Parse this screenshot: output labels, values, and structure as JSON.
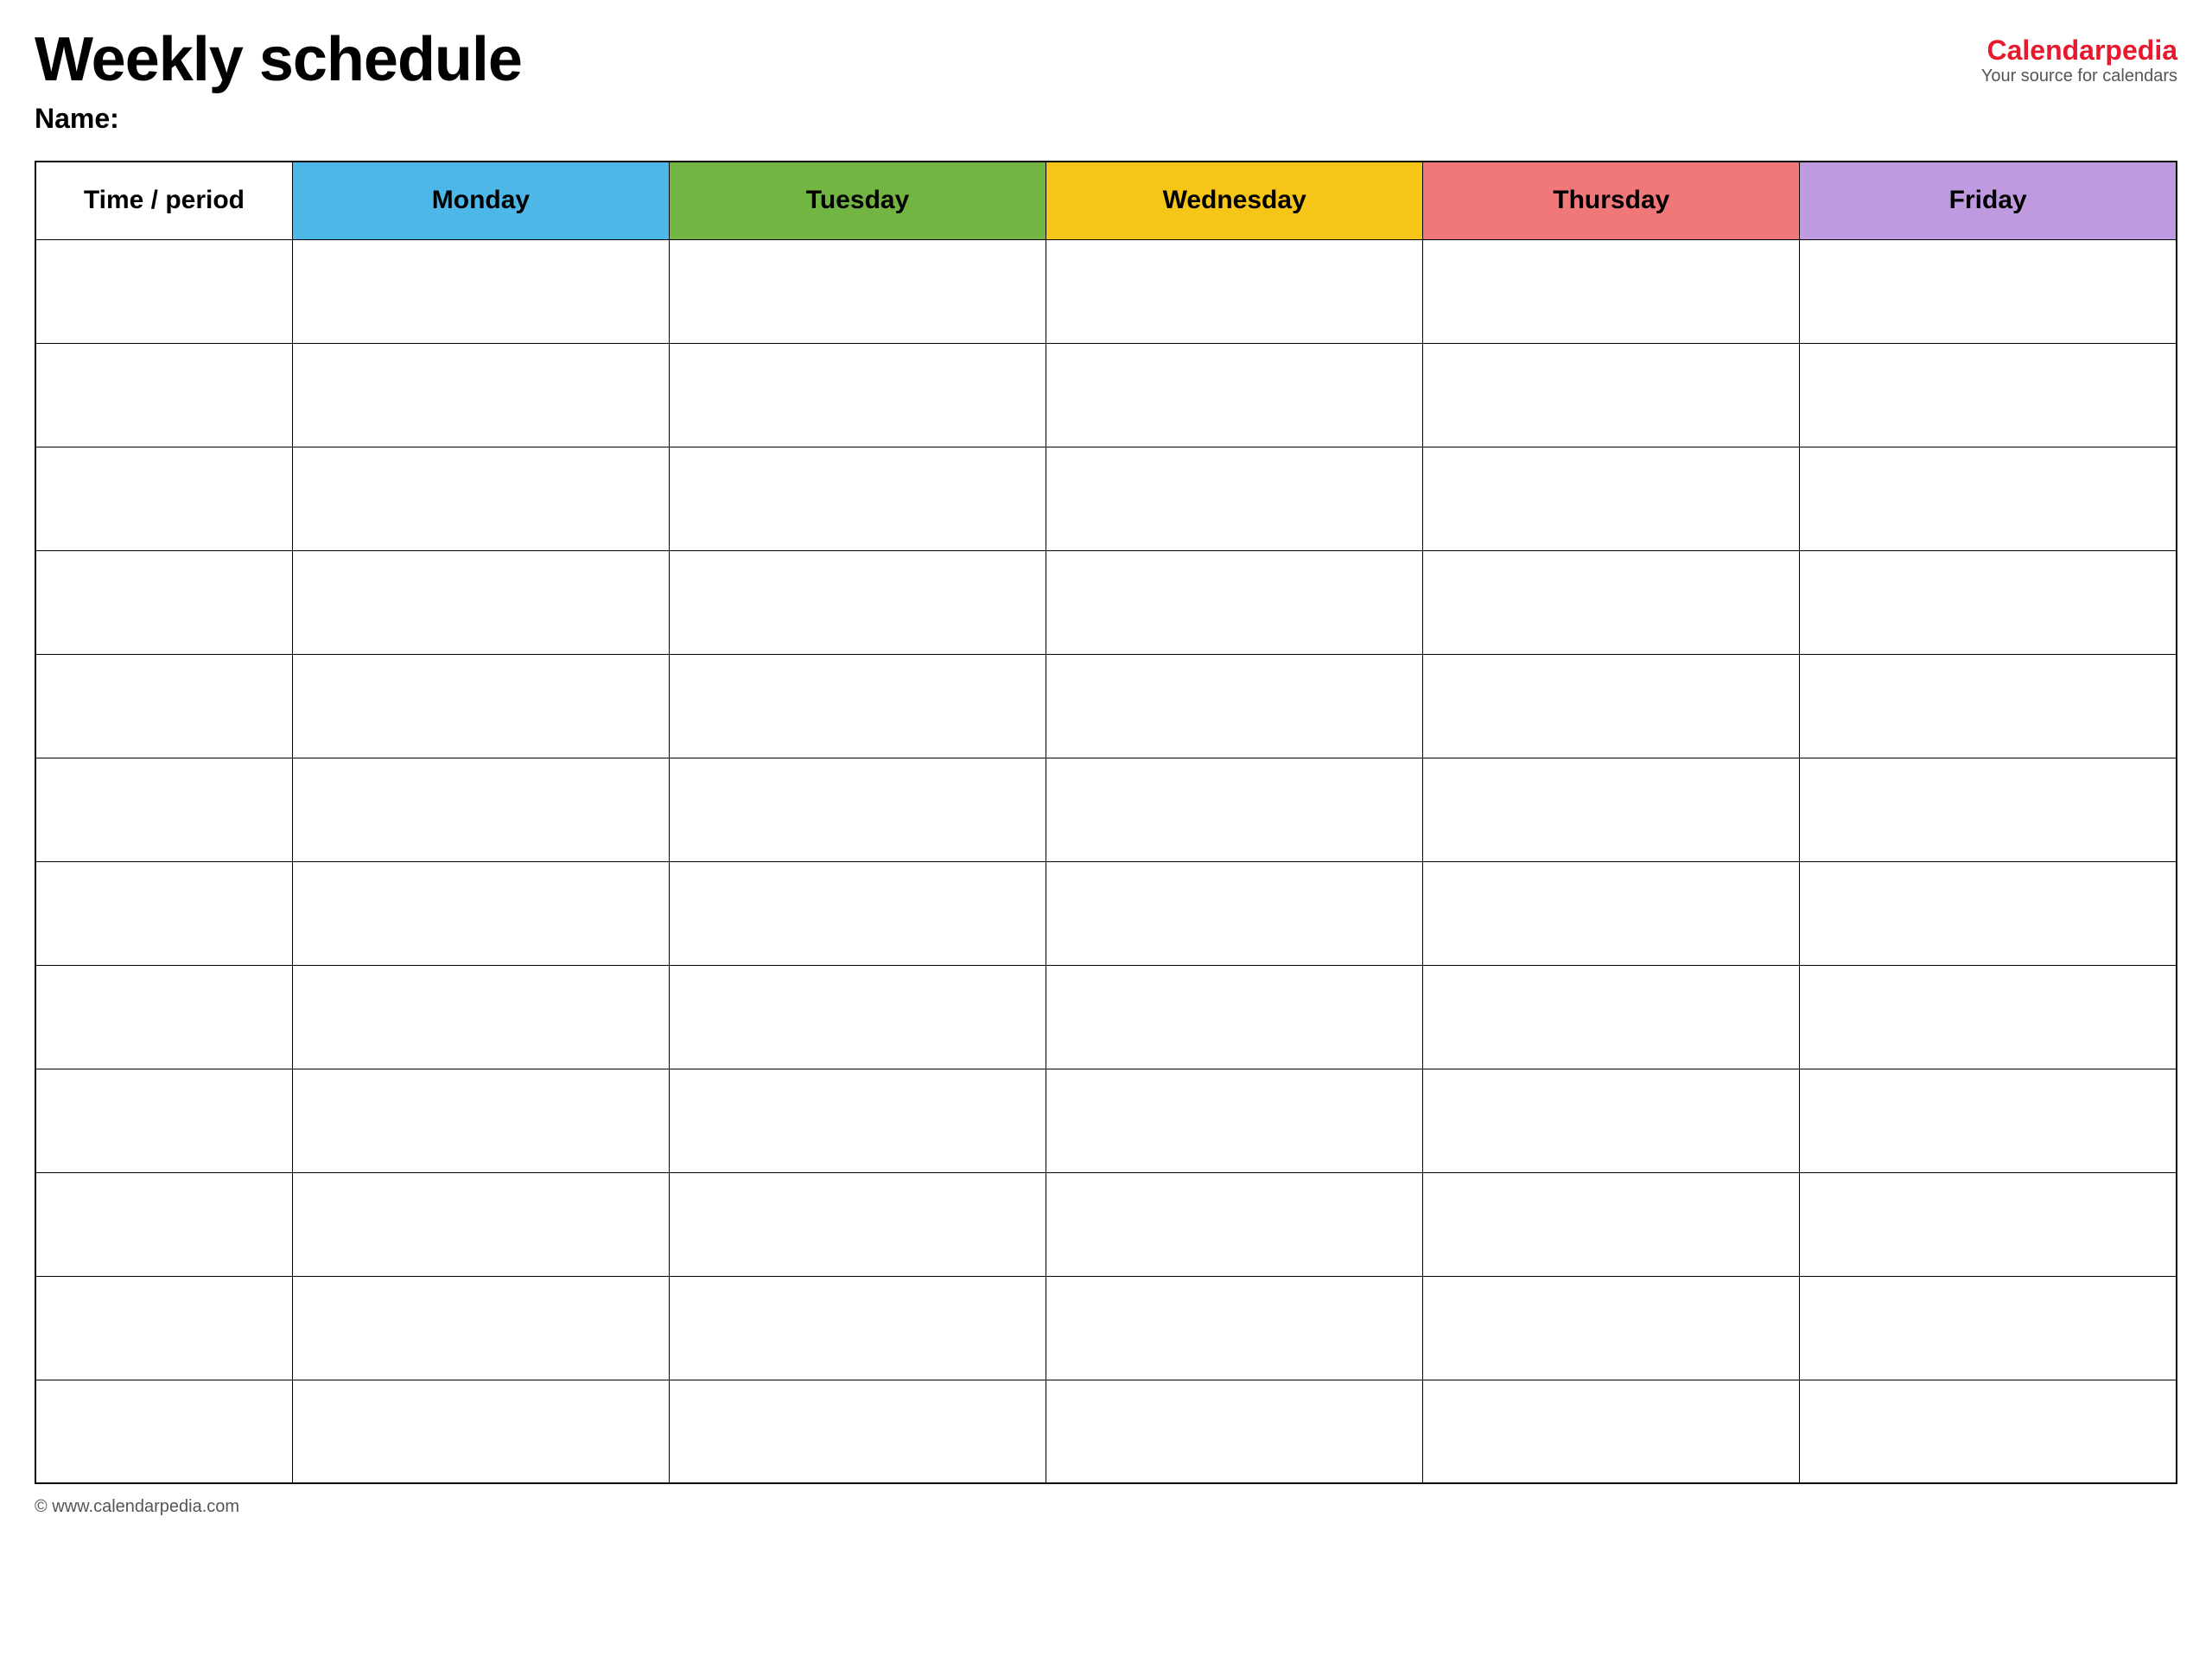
{
  "header": {
    "title": "Weekly schedule",
    "name_label": "Name:",
    "logo": {
      "text_black": "Calendar",
      "text_red": "pedia",
      "tagline": "Your source for calendars"
    }
  },
  "table": {
    "columns": [
      {
        "id": "time",
        "label": "Time / period",
        "color": "#ffffff",
        "class": "th-time"
      },
      {
        "id": "monday",
        "label": "Monday",
        "color": "#4db8e8",
        "class": "th-monday"
      },
      {
        "id": "tuesday",
        "label": "Tuesday",
        "color": "#72b543",
        "class": "th-tuesday"
      },
      {
        "id": "wednesday",
        "label": "Wednesday",
        "color": "#f5c518",
        "class": "th-wednesday"
      },
      {
        "id": "thursday",
        "label": "Thursday",
        "color": "#f07878",
        "class": "th-thursday"
      },
      {
        "id": "friday",
        "label": "Friday",
        "color": "#c09ae0",
        "class": "th-friday"
      }
    ],
    "row_count": 12
  },
  "footer": {
    "url": "© www.calendarpedia.com"
  }
}
